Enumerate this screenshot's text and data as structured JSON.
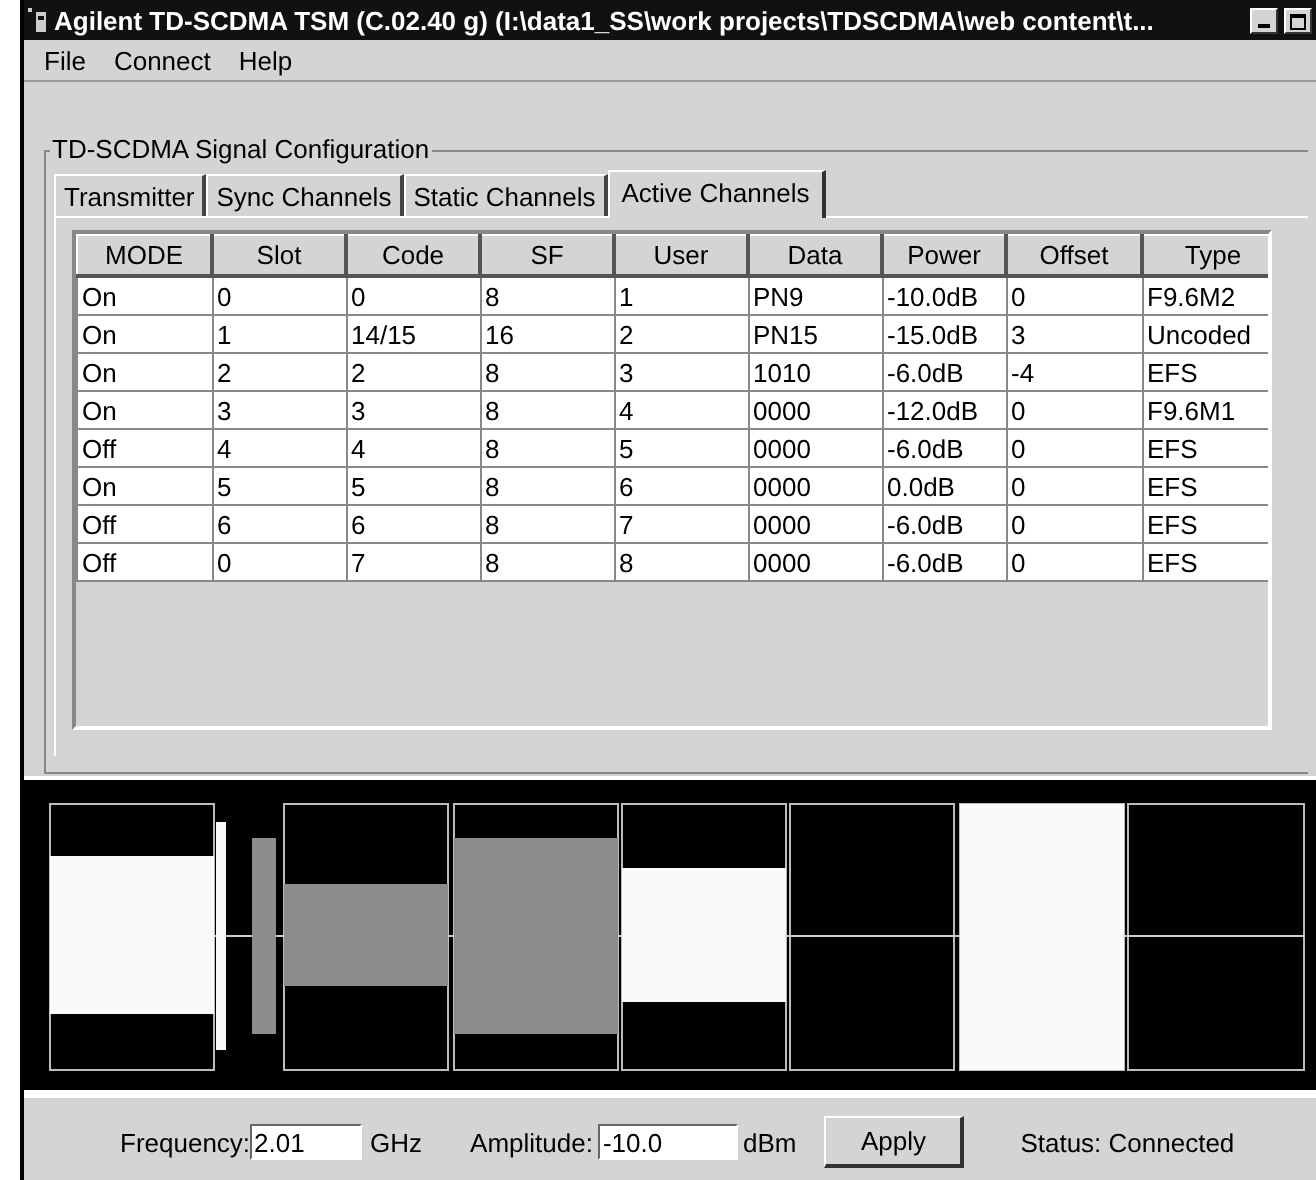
{
  "window": {
    "title": "Agilent TD-SCDMA TSM (C.02.40 g) (I:\\data1_SS\\work projects\\TDSCDMA\\web content\\t..."
  },
  "menu": [
    "File",
    "Connect",
    "Help"
  ],
  "panel": {
    "title": "TD-SCDMA Signal Configuration"
  },
  "tabs": [
    {
      "label": "Transmitter",
      "selected": false
    },
    {
      "label": "Sync Channels",
      "selected": false
    },
    {
      "label": "Static Channels",
      "selected": false
    },
    {
      "label": "Active Channels",
      "selected": true
    }
  ],
  "table": {
    "columns": [
      "MODE",
      "Slot",
      "Code",
      "SF",
      "User",
      "Data",
      "Power",
      "Offset",
      "Type"
    ],
    "rows": [
      [
        "On",
        "0",
        "0",
        "8",
        "1",
        "PN9",
        "-10.0dB",
        "0",
        "F9.6M2"
      ],
      [
        "On",
        "1",
        "14/15",
        "16",
        "2",
        "PN15",
        "-15.0dB",
        "3",
        "Uncoded"
      ],
      [
        "On",
        "2",
        "2",
        "8",
        "3",
        "1010",
        "-6.0dB",
        "-4",
        "EFS"
      ],
      [
        "On",
        "3",
        "3",
        "8",
        "4",
        "0000",
        "-12.0dB",
        "0",
        "F9.6M1"
      ],
      [
        "Off",
        "4",
        "4",
        "8",
        "5",
        "0000",
        "-6.0dB",
        "0",
        "EFS"
      ],
      [
        "On",
        "5",
        "5",
        "8",
        "6",
        "0000",
        "0.0dB",
        "0",
        "EFS"
      ],
      [
        "Off",
        "6",
        "6",
        "8",
        "7",
        "0000",
        "-6.0dB",
        "0",
        "EFS"
      ],
      [
        "Off",
        "0",
        "7",
        "8",
        "8",
        "0000",
        "-6.0dB",
        "0",
        "EFS"
      ]
    ]
  },
  "controls": {
    "frequency_label": "Frequency:",
    "frequency": "2.01",
    "frequency_unit": "GHz",
    "amplitude_label": "Amplitude:",
    "amplitude": "-10.0",
    "amplitude_unit": "dBm",
    "apply": "Apply",
    "status": "Status: Connected"
  }
}
